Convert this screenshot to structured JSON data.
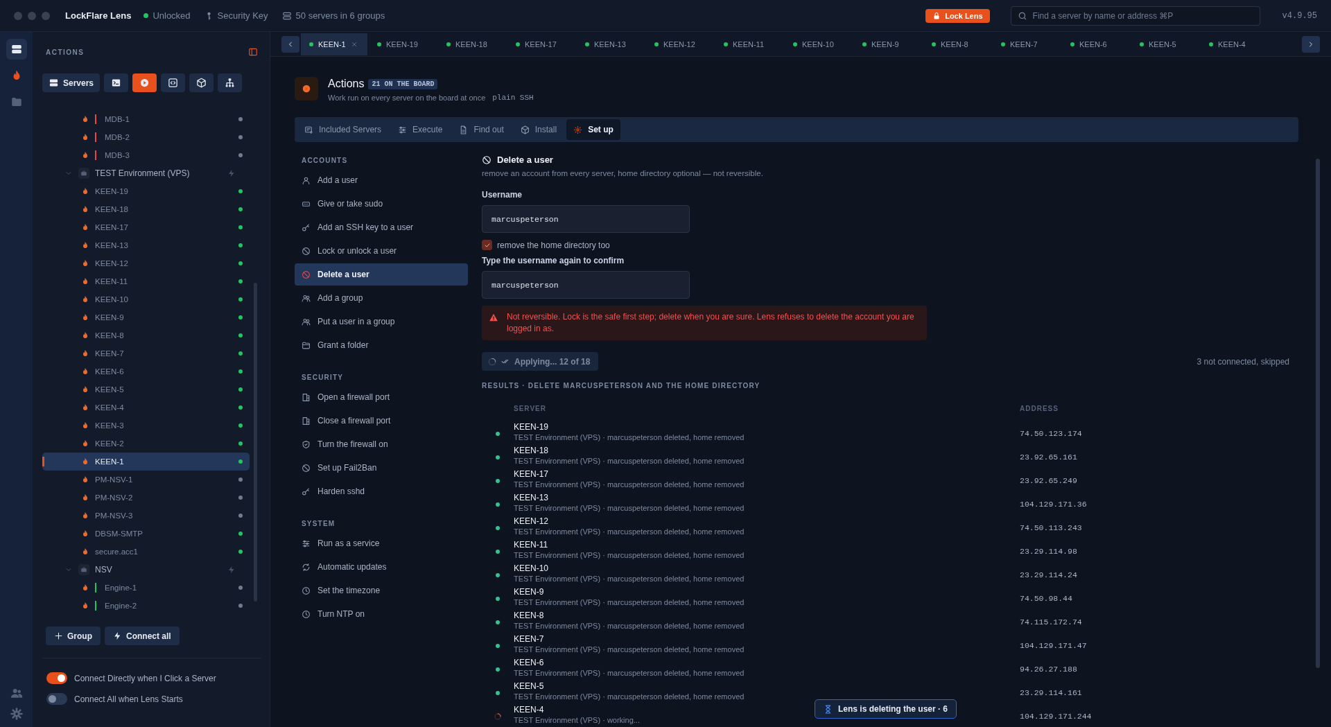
{
  "app": {
    "title": "LockFlare Lens",
    "status": "Unlocked",
    "key": "Security Key",
    "summary": "50 servers in 6 groups",
    "lock_button": "Lock Lens",
    "search": {
      "placeholder": "Find a server by name or address ⌘P"
    },
    "version": "v4.9.95"
  },
  "rail": [
    {
      "selected": true
    },
    {
      "selected": false
    },
    {
      "selected": false
    }
  ],
  "sidebar": {
    "title": "ACTIONS",
    "toolbar": [
      {
        "label": "Servers",
        "selected": false
      },
      {
        "selected": false
      },
      {
        "selected": true
      },
      {
        "selected": false
      },
      {
        "selected": false
      },
      {
        "selected": false
      }
    ],
    "tree": [
      {
        "kind": "server",
        "name": "MDB-1",
        "connected": false,
        "selected": false,
        "color": "#ef4444"
      },
      {
        "kind": "server",
        "name": "MDB-2",
        "connected": false,
        "selected": false,
        "color": "#ef4444"
      },
      {
        "kind": "server",
        "name": "MDB-3",
        "connected": false,
        "selected": false,
        "color": "#ef4444"
      },
      {
        "kind": "group",
        "name": "TEST Environment (VPS)",
        "expanded": true,
        "children": [
          {
            "kind": "server",
            "name": "KEEN-19",
            "connected": true,
            "selected": false
          },
          {
            "kind": "server",
            "name": "KEEN-18",
            "connected": true,
            "selected": false
          },
          {
            "kind": "server",
            "name": "KEEN-17",
            "connected": true,
            "selected": false
          },
          {
            "kind": "server",
            "name": "KEEN-13",
            "connected": true,
            "selected": false
          },
          {
            "kind": "server",
            "name": "KEEN-12",
            "connected": true,
            "selected": false
          },
          {
            "kind": "server",
            "name": "KEEN-11",
            "connected": true,
            "selected": false
          },
          {
            "kind": "server",
            "name": "KEEN-10",
            "connected": true,
            "selected": false
          },
          {
            "kind": "server",
            "name": "KEEN-9",
            "connected": true,
            "selected": false
          },
          {
            "kind": "server",
            "name": "KEEN-8",
            "connected": true,
            "selected": false
          },
          {
            "kind": "server",
            "name": "KEEN-7",
            "connected": true,
            "selected": false
          },
          {
            "kind": "server",
            "name": "KEEN-6",
            "connected": true,
            "selected": false
          },
          {
            "kind": "server",
            "name": "KEEN-5",
            "connected": true,
            "selected": false
          },
          {
            "kind": "server",
            "name": "KEEN-4",
            "connected": true,
            "selected": false
          },
          {
            "kind": "server",
            "name": "KEEN-3",
            "connected": true,
            "selected": false
          },
          {
            "kind": "server",
            "name": "KEEN-2",
            "connected": true,
            "selected": false
          },
          {
            "kind": "server",
            "name": "KEEN-1",
            "connected": true,
            "selected": true
          },
          {
            "kind": "server",
            "name": "PM-NSV-1",
            "connected": false,
            "selected": false
          },
          {
            "kind": "server",
            "name": "PM-NSV-2",
            "connected": false,
            "selected": false
          },
          {
            "kind": "server",
            "name": "PM-NSV-3",
            "connected": false,
            "selected": false
          },
          {
            "kind": "server",
            "name": "DBSM-SMTP",
            "connected": true,
            "selected": false
          },
          {
            "kind": "server",
            "name": "secure.acc1",
            "connected": true,
            "selected": false
          }
        ]
      },
      {
        "kind": "group",
        "name": "NSV",
        "expanded": true,
        "children": [
          {
            "kind": "server",
            "name": "Engine-1",
            "connected": false,
            "selected": false,
            "color": "#22c55e"
          },
          {
            "kind": "server",
            "name": "Engine-2",
            "connected": false,
            "selected": false,
            "color": "#22c55e"
          }
        ]
      }
    ],
    "buttons": [
      "Group",
      "Connect all"
    ],
    "toggles": [
      {
        "label": "Connect Directly when I Click a Server",
        "on": true
      },
      {
        "label": "Connect All when Lens Starts",
        "on": false
      }
    ]
  },
  "tabs": [
    {
      "label": "KEEN-1",
      "selected": true
    },
    {
      "label": "KEEN-19",
      "selected": false
    },
    {
      "label": "KEEN-18",
      "selected": false
    },
    {
      "label": "KEEN-17",
      "selected": false
    },
    {
      "label": "KEEN-13",
      "selected": false
    },
    {
      "label": "KEEN-12",
      "selected": false
    },
    {
      "label": "KEEN-11",
      "selected": false
    },
    {
      "label": "KEEN-10",
      "selected": false
    },
    {
      "label": "KEEN-9",
      "selected": false
    },
    {
      "label": "KEEN-8",
      "selected": false
    },
    {
      "label": "KEEN-7",
      "selected": false
    },
    {
      "label": "KEEN-6",
      "selected": false
    },
    {
      "label": "KEEN-5",
      "selected": false
    },
    {
      "label": "KEEN-4",
      "selected": false
    }
  ],
  "actions": {
    "title": "Actions",
    "badge": "21 ON THE BOARD",
    "subtitle": "Work run on every server on the board at once",
    "code": "plain SSH",
    "tabs": [
      {
        "label": "Included Servers",
        "selected": false
      },
      {
        "label": "Execute",
        "selected": false
      },
      {
        "label": "Find out",
        "selected": false
      },
      {
        "label": "Install",
        "selected": false
      },
      {
        "label": "Set up",
        "selected": true
      }
    ],
    "menu": [
      {
        "title": "ACCOUNTS",
        "items": [
          {
            "label": "Add a user",
            "selected": false
          },
          {
            "label": "Give or take sudo",
            "selected": false
          },
          {
            "label": "Add an SSH key to a user",
            "selected": false
          },
          {
            "label": "Lock or unlock a user",
            "selected": false
          },
          {
            "label": "Delete a user",
            "selected": true
          },
          {
            "label": "Add a group",
            "selected": false
          },
          {
            "label": "Put a user in a group",
            "selected": false
          },
          {
            "label": "Grant a folder",
            "selected": false
          }
        ]
      },
      {
        "title": "SECURITY",
        "items": [
          {
            "label": "Open a firewall port",
            "selected": false
          },
          {
            "label": "Close a firewall port",
            "selected": false
          },
          {
            "label": "Turn the firewall on",
            "selected": false
          },
          {
            "label": "Set up Fail2Ban",
            "selected": false
          },
          {
            "label": "Harden sshd",
            "selected": false
          }
        ]
      },
      {
        "title": "SYSTEM",
        "items": [
          {
            "label": "Run as a service",
            "selected": false
          },
          {
            "label": "Automatic updates",
            "selected": false
          },
          {
            "label": "Set the timezone",
            "selected": false
          },
          {
            "label": "Turn NTP on",
            "selected": false
          }
        ]
      }
    ],
    "form": {
      "title": "Delete a user",
      "description": "remove an account from every server, home directory optional — not reversible.",
      "username": {
        "label": "Username",
        "value": "marcuspeterson"
      },
      "remove_home": {
        "label": "remove the home directory too",
        "checked": true
      },
      "confirm": {
        "label": "Type the username again to confirm",
        "value": "marcuspeterson"
      },
      "warning": "Not reversible. Lock is the safe first step; delete when you are sure. Lens refuses to delete the account you are logged in as.",
      "progress": "Applying... 12 of 18",
      "skipped": "3 not connected, skipped",
      "results": {
        "title": "RESULTS · DELETE MARCUSPETERSON AND THE HOME DIRECTORY",
        "columns": [
          "SERVER",
          "ADDRESS"
        ],
        "rows": [
          {
            "working": false,
            "server": "KEEN-19",
            "detail": "TEST Environment (VPS) · marcuspeterson deleted, home removed",
            "address": "74.50.123.174"
          },
          {
            "working": false,
            "server": "KEEN-18",
            "detail": "TEST Environment (VPS) · marcuspeterson deleted, home removed",
            "address": "23.92.65.161"
          },
          {
            "working": false,
            "server": "KEEN-17",
            "detail": "TEST Environment (VPS) · marcuspeterson deleted, home removed",
            "address": "23.92.65.249"
          },
          {
            "working": false,
            "server": "KEEN-13",
            "detail": "TEST Environment (VPS) · marcuspeterson deleted, home removed",
            "address": "104.129.171.36"
          },
          {
            "working": false,
            "server": "KEEN-12",
            "detail": "TEST Environment (VPS) · marcuspeterson deleted, home removed",
            "address": "74.50.113.243"
          },
          {
            "working": false,
            "server": "KEEN-11",
            "detail": "TEST Environment (VPS) · marcuspeterson deleted, home removed",
            "address": "23.29.114.98"
          },
          {
            "working": false,
            "server": "KEEN-10",
            "detail": "TEST Environment (VPS) · marcuspeterson deleted, home removed",
            "address": "23.29.114.24"
          },
          {
            "working": false,
            "server": "KEEN-9",
            "detail": "TEST Environment (VPS) · marcuspeterson deleted, home removed",
            "address": "74.50.98.44"
          },
          {
            "working": false,
            "server": "KEEN-8",
            "detail": "TEST Environment (VPS) · marcuspeterson deleted, home removed",
            "address": "74.115.172.74"
          },
          {
            "working": false,
            "server": "KEEN-7",
            "detail": "TEST Environment (VPS) · marcuspeterson deleted, home removed",
            "address": "104.129.171.47"
          },
          {
            "working": false,
            "server": "KEEN-6",
            "detail": "TEST Environment (VPS) · marcuspeterson deleted, home removed",
            "address": "94.26.27.188"
          },
          {
            "working": false,
            "server": "KEEN-5",
            "detail": "TEST Environment (VPS) · marcuspeterson deleted, home removed",
            "address": "23.29.114.161"
          },
          {
            "working": true,
            "server": "KEEN-4",
            "detail": "TEST Environment (VPS) · working...",
            "address": "104.129.171.244"
          }
        ]
      }
    }
  },
  "toast": "Lens is deleting the user · 6"
}
